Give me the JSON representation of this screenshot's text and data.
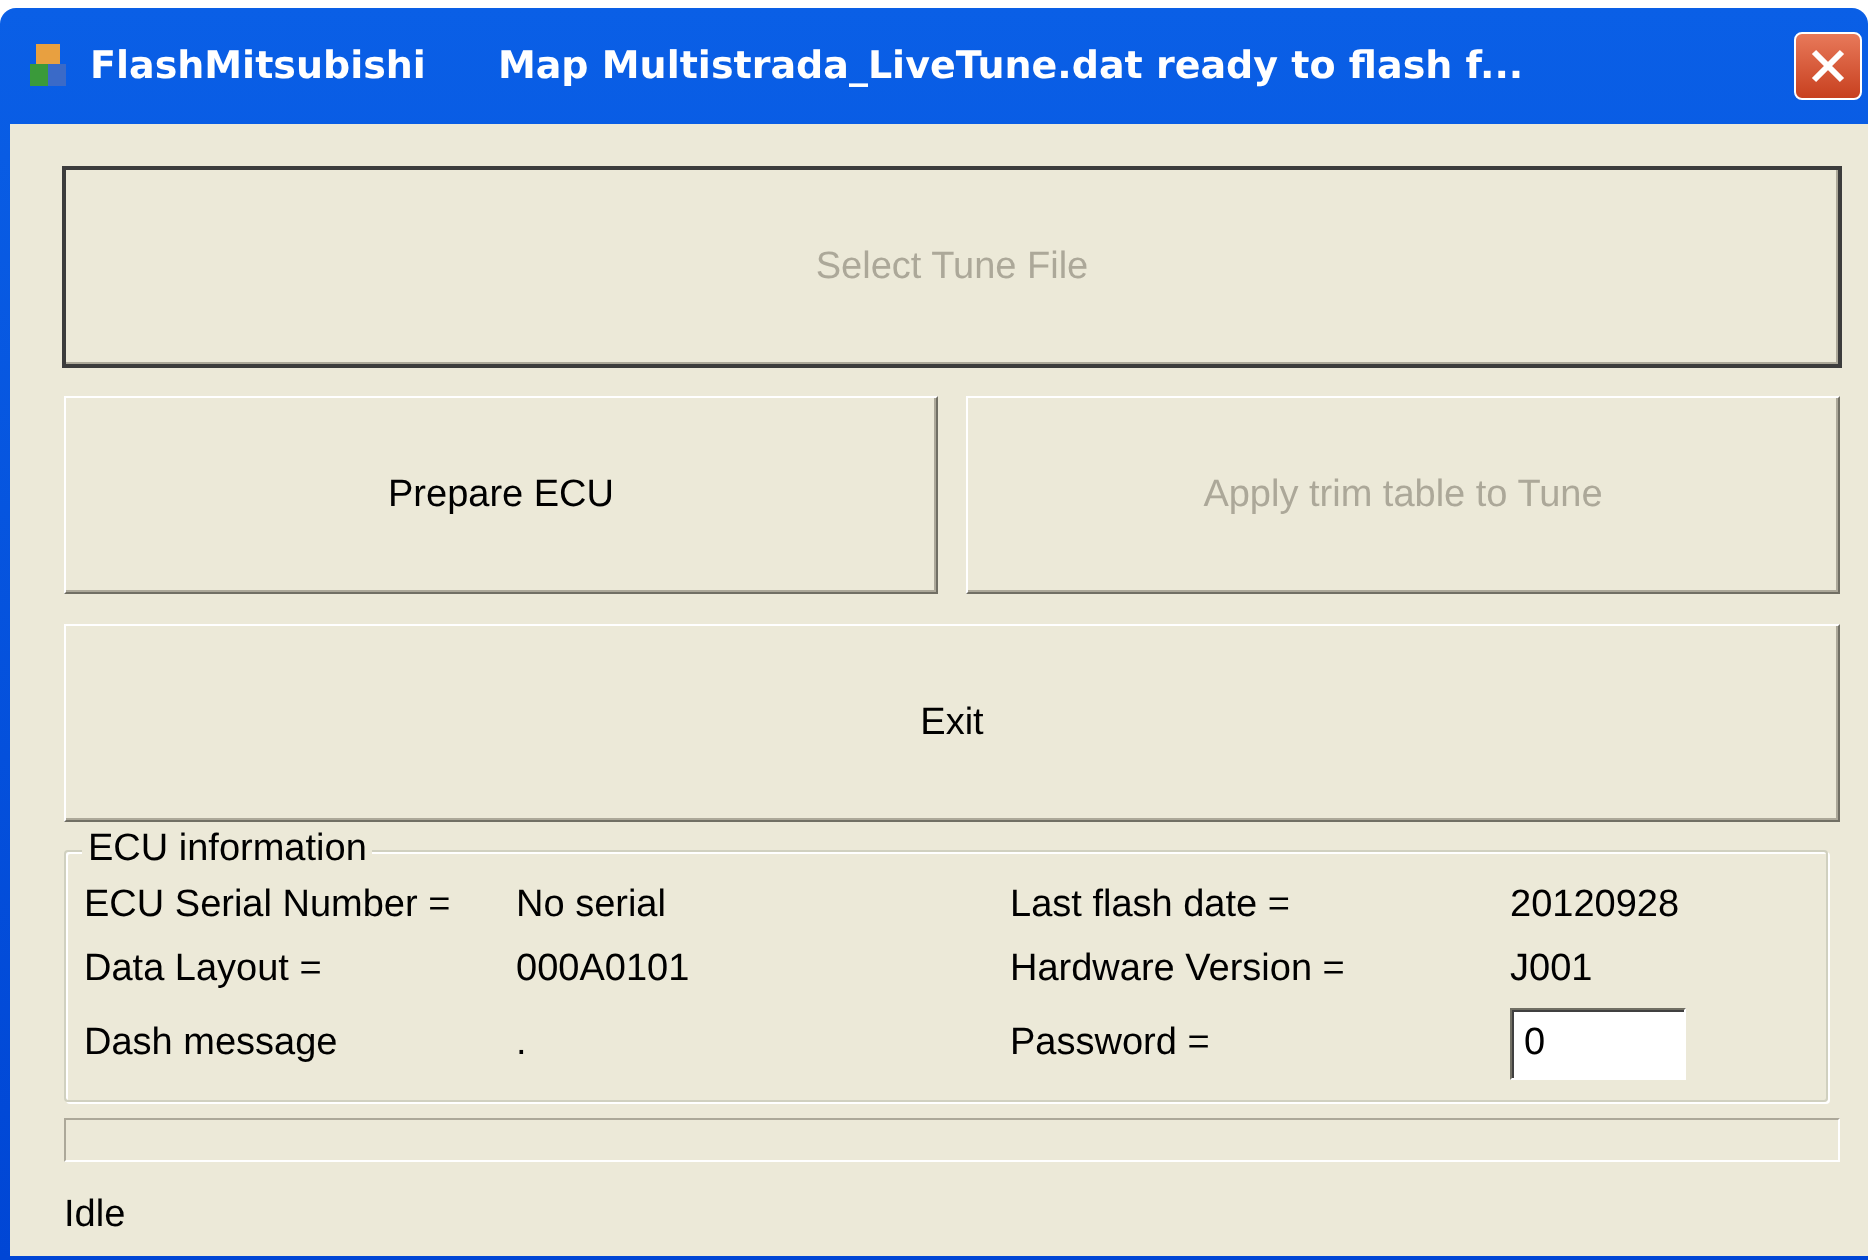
{
  "window": {
    "title": "FlashMitsubishi",
    "message": "Map Multistrada_LiveTune.dat ready to flash f..."
  },
  "buttons": [
    {
      "label": "Select Tune File",
      "disabled": true,
      "default": true
    },
    {
      "label": "Prepare ECU",
      "disabled": false,
      "default": false
    },
    {
      "label": "Apply trim table to Tune",
      "disabled": true,
      "default": false
    },
    {
      "label": "Exit",
      "disabled": false,
      "default": false
    }
  ],
  "ecu_information": {
    "title": "ECU information",
    "rows": [
      [
        {
          "label": "ECU Serial Number =",
          "value": "No serial"
        },
        {
          "label": "Last flash date =",
          "value": "20120928"
        }
      ],
      [
        {
          "label": "Data Layout =",
          "value": "000A0101"
        },
        {
          "label": "Hardware Version =",
          "value": "J001"
        }
      ],
      [
        {
          "label": "Dash message",
          "value": "."
        },
        {
          "label": "Password =",
          "value": "0",
          "kind": "field"
        }
      ]
    ]
  },
  "status_bar": "Idle"
}
